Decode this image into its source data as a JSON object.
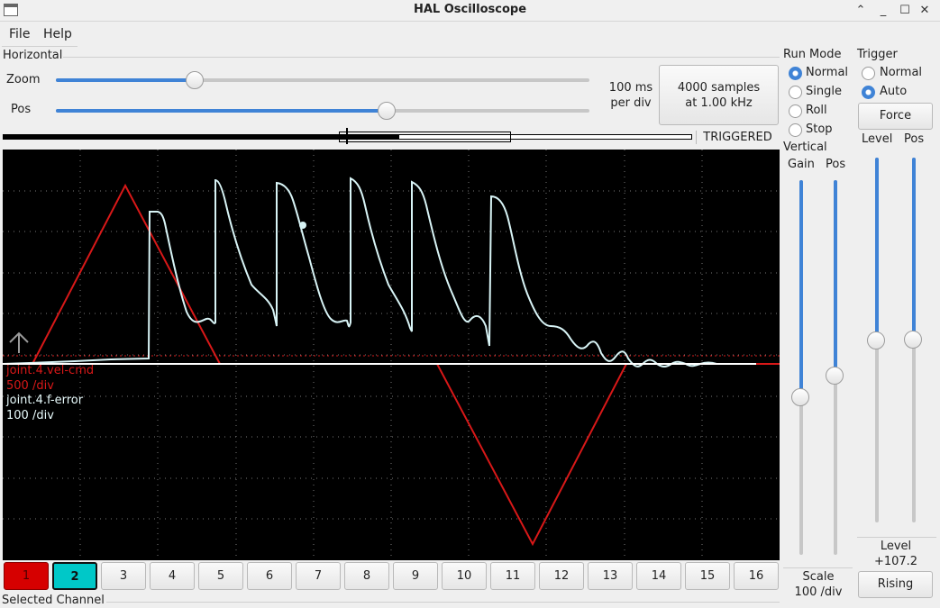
{
  "window": {
    "title": "HAL Oscilloscope"
  },
  "menu": {
    "file": "File",
    "help": "Help"
  },
  "horizontal": {
    "group_label": "Horizontal",
    "zoom_label": "Zoom",
    "pos_label": "Pos",
    "zoom_value": 0.26,
    "pos_value": 0.62,
    "timebase_value": "100 ms",
    "timebase_unit": "per div",
    "samples_line1": "4000 samples",
    "samples_line2": "at 1.00 kHz",
    "status": "TRIGGERED"
  },
  "run_mode": {
    "label": "Run Mode",
    "options": [
      "Normal",
      "Single",
      "Roll",
      "Stop"
    ],
    "selected": "Normal"
  },
  "trigger": {
    "label": "Trigger",
    "options": [
      "Normal",
      "Auto"
    ],
    "selected": "Auto",
    "force_label": "Force",
    "level_label": "Level",
    "pos_label": "Pos",
    "level_title": "Level",
    "level_value": "+107.2",
    "edge_label": "Rising"
  },
  "vertical": {
    "label": "Vertical",
    "gain_label": "Gain",
    "pos_label": "Pos",
    "scale_label": "Scale",
    "scale_value": "100 /div"
  },
  "traces": [
    {
      "name": "joint.4.vel-cmd",
      "scale": "500 /div",
      "color": "#d81818"
    },
    {
      "name": "joint.4.f-error",
      "scale": "100 /div",
      "color": "#cfeff3"
    }
  ],
  "channels": [
    "1",
    "2",
    "3",
    "4",
    "5",
    "6",
    "7",
    "8",
    "9",
    "10",
    "11",
    "12",
    "13",
    "14",
    "15",
    "16"
  ],
  "channel_colors": {
    "1": "#d60000",
    "2": "#00c8c8"
  },
  "selected_channel_label": "Selected Channel"
}
